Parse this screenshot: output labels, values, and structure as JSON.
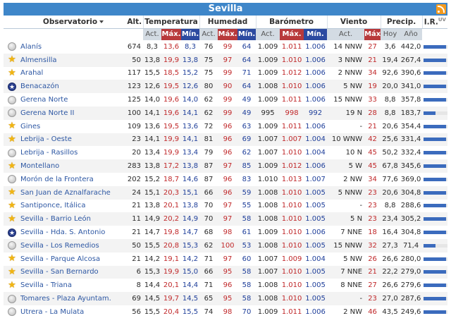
{
  "title": "Sevilla",
  "headers": {
    "observatorio": "Observatorio",
    "alt": "Alt.",
    "temperatura": "Temperatura",
    "humedad": "Humedad",
    "barometro": "Barómetro",
    "viento": "Viento",
    "precip": "Precip.",
    "ir": "I.R.",
    "ir_sup": "UV",
    "act": "Act.",
    "max": "Máx.",
    "min": "Mín.",
    "hoy": "Hoy",
    "ano": "Año"
  },
  "colors": {
    "title_bg": "#3e86c9",
    "max": "#c0282a",
    "min": "#1f3f9a",
    "link": "#2d57a3",
    "bar": "#3b6bbd"
  },
  "rows": [
    {
      "icon": "gray",
      "name": "Alanís",
      "alt": "674",
      "t_act": "8,3",
      "t_max": "13,6",
      "t_min": "8,3",
      "h_act": "76",
      "h_max": "99",
      "h_min": "64",
      "b_act": "1.009",
      "b_max": "1.011",
      "b_min": "1.006",
      "w_act": "14 NNW",
      "w_max": "27",
      "p_hoy": "3,6",
      "p_ano": "442,0",
      "ir": 0.95
    },
    {
      "icon": "star",
      "name": "Almensilla",
      "alt": "50",
      "t_act": "13,8",
      "t_max": "19,9",
      "t_min": "13,8",
      "h_act": "75",
      "h_max": "97",
      "h_min": "64",
      "b_act": "1.009",
      "b_max": "1.010",
      "b_min": "1.006",
      "w_act": "3 NNW",
      "w_max": "21",
      "p_hoy": "19,4",
      "p_ano": "267,4",
      "ir": 0.95
    },
    {
      "icon": "star",
      "name": "Arahal",
      "alt": "117",
      "t_act": "15,5",
      "t_max": "18,5",
      "t_min": "15,2",
      "h_act": "75",
      "h_max": "99",
      "h_min": "71",
      "b_act": "1.009",
      "b_max": "1.012",
      "b_min": "1.006",
      "w_act": "2 NNW",
      "w_max": "34",
      "p_hoy": "92,6",
      "p_ano": "390,6",
      "ir": 0.95
    },
    {
      "icon": "bluestar",
      "name": "Benacazón",
      "alt": "123",
      "t_act": "12,6",
      "t_max": "19,5",
      "t_min": "12,6",
      "h_act": "80",
      "h_max": "90",
      "h_min": "64",
      "b_act": "1.008",
      "b_max": "1.010",
      "b_min": "1.006",
      "w_act": "5 NW",
      "w_max": "19",
      "p_hoy": "20,0",
      "p_ano": "341,0",
      "ir": 0.95
    },
    {
      "icon": "gray",
      "name": "Gerena Norte",
      "alt": "125",
      "t_act": "14,0",
      "t_max": "19,6",
      "t_min": "14,0",
      "h_act": "62",
      "h_max": "99",
      "h_min": "49",
      "b_act": "1.009",
      "b_max": "1.011",
      "b_min": "1.006",
      "w_act": "15 NNW",
      "w_max": "33",
      "p_hoy": "8,8",
      "p_ano": "357,8",
      "ir": 0.95
    },
    {
      "icon": "gray",
      "name": "Gerena Norte II",
      "alt": "100",
      "t_act": "14,1",
      "t_max": "19,6",
      "t_min": "14,1",
      "h_act": "62",
      "h_max": "99",
      "h_min": "49",
      "b_act": "995",
      "b_max": "998",
      "b_min": "992",
      "w_act": "19 N",
      "w_max": "28",
      "p_hoy": "8,8",
      "p_ano": "183,7",
      "ir": 0.5
    },
    {
      "icon": "star",
      "name": "Gines",
      "alt": "109",
      "t_act": "13,6",
      "t_max": "19,5",
      "t_min": "13,6",
      "h_act": "72",
      "h_max": "96",
      "h_min": "63",
      "b_act": "1.009",
      "b_max": "1.011",
      "b_min": "1.006",
      "w_act": "-",
      "w_max": "21",
      "p_hoy": "20,6",
      "p_ano": "354,4",
      "ir": 0.95
    },
    {
      "icon": "star",
      "name": "Lebrija - Oeste",
      "alt": "23",
      "t_act": "14,1",
      "t_max": "19,9",
      "t_min": "14,1",
      "h_act": "81",
      "h_max": "96",
      "h_min": "69",
      "b_act": "1.007",
      "b_max": "1.007",
      "b_min": "1.004",
      "w_act": "10 WNW",
      "w_max": "42",
      "p_hoy": "25,6",
      "p_ano": "331,4",
      "ir": 0.95
    },
    {
      "icon": "gray",
      "name": "Lebrija - Rasillos",
      "alt": "20",
      "t_act": "13,4",
      "t_max": "19,9",
      "t_min": "13,4",
      "h_act": "79",
      "h_max": "96",
      "h_min": "62",
      "b_act": "1.007",
      "b_max": "1.010",
      "b_min": "1.004",
      "w_act": "10 N",
      "w_max": "45",
      "p_hoy": "50,2",
      "p_ano": "332,4",
      "ir": 0.95
    },
    {
      "icon": "star",
      "name": "Montellano",
      "alt": "283",
      "t_act": "13,8",
      "t_max": "17,2",
      "t_min": "13,8",
      "h_act": "87",
      "h_max": "97",
      "h_min": "85",
      "b_act": "1.009",
      "b_max": "1.012",
      "b_min": "1.006",
      "w_act": "5 W",
      "w_max": "45",
      "p_hoy": "67,8",
      "p_ano": "345,6",
      "ir": 0.95
    },
    {
      "icon": "gray",
      "name": "Morón de la Frontera",
      "alt": "202",
      "t_act": "15,2",
      "t_max": "18,7",
      "t_min": "14,6",
      "h_act": "87",
      "h_max": "96",
      "h_min": "83",
      "b_act": "1.010",
      "b_max": "1.013",
      "b_min": "1.007",
      "w_act": "2 NW",
      "w_max": "34",
      "p_hoy": "77,6",
      "p_ano": "369,0",
      "ir": 0.95
    },
    {
      "icon": "star",
      "name": "San Juan de Aznalfarache",
      "alt": "24",
      "t_act": "15,1",
      "t_max": "20,3",
      "t_min": "15,1",
      "h_act": "66",
      "h_max": "96",
      "h_min": "59",
      "b_act": "1.008",
      "b_max": "1.010",
      "b_min": "1.005",
      "w_act": "5 NNW",
      "w_max": "23",
      "p_hoy": "20,6",
      "p_ano": "304,8",
      "ir": 0.95
    },
    {
      "icon": "star",
      "name": "Santiponce, Itálica",
      "alt": "21",
      "t_act": "13,8",
      "t_max": "20,1",
      "t_min": "13,8",
      "h_act": "70",
      "h_max": "97",
      "h_min": "55",
      "b_act": "1.008",
      "b_max": "1.010",
      "b_min": "1.005",
      "w_act": "-",
      "w_max": "23",
      "p_hoy": "8,8",
      "p_ano": "288,6",
      "ir": 0.95
    },
    {
      "icon": "star",
      "name": "Sevilla - Barrio León",
      "alt": "11",
      "t_act": "14,9",
      "t_max": "20,2",
      "t_min": "14,9",
      "h_act": "70",
      "h_max": "97",
      "h_min": "58",
      "b_act": "1.008",
      "b_max": "1.010",
      "b_min": "1.005",
      "w_act": "5 N",
      "w_max": "23",
      "p_hoy": "23,4",
      "p_ano": "305,2",
      "ir": 0.95
    },
    {
      "icon": "bluestar",
      "name": "Sevilla - Hda. S. Antonio",
      "alt": "21",
      "t_act": "14,7",
      "t_max": "19,8",
      "t_min": "14,7",
      "h_act": "68",
      "h_max": "98",
      "h_min": "61",
      "b_act": "1.009",
      "b_max": "1.010",
      "b_min": "1.006",
      "w_act": "7 NNE",
      "w_max": "18",
      "p_hoy": "16,4",
      "p_ano": "304,8",
      "ir": 0.95
    },
    {
      "icon": "gray",
      "name": "Sevilla - Los Remedios",
      "alt": "50",
      "t_act": "15,5",
      "t_max": "20,8",
      "t_min": "15,3",
      "h_act": "62",
      "h_max": "100",
      "h_min": "53",
      "b_act": "1.008",
      "b_max": "1.010",
      "b_min": "1.005",
      "w_act": "15 NNW",
      "w_max": "32",
      "p_hoy": "27,3",
      "p_ano": "71,4",
      "ir": 0.5
    },
    {
      "icon": "star",
      "name": "Sevilla - Parque Alcosa",
      "alt": "21",
      "t_act": "14,2",
      "t_max": "19,1",
      "t_min": "14,2",
      "h_act": "71",
      "h_max": "97",
      "h_min": "60",
      "b_act": "1.007",
      "b_max": "1.009",
      "b_min": "1.004",
      "w_act": "5 NW",
      "w_max": "26",
      "p_hoy": "26,6",
      "p_ano": "280,0",
      "ir": 0.95
    },
    {
      "icon": "star",
      "name": "Sevilla - San Bernardo",
      "alt": "6",
      "t_act": "15,3",
      "t_max": "19,9",
      "t_min": "15,0",
      "h_act": "66",
      "h_max": "95",
      "h_min": "58",
      "b_act": "1.007",
      "b_max": "1.010",
      "b_min": "1.005",
      "w_act": "7 NNE",
      "w_max": "21",
      "p_hoy": "22,2",
      "p_ano": "279,0",
      "ir": 0.95
    },
    {
      "icon": "star",
      "name": "Sevilla - Triana",
      "alt": "8",
      "t_act": "14,4",
      "t_max": "20,1",
      "t_min": "14,4",
      "h_act": "71",
      "h_max": "96",
      "h_min": "58",
      "b_act": "1.008",
      "b_max": "1.010",
      "b_min": "1.005",
      "w_act": "8 NNE",
      "w_max": "27",
      "p_hoy": "26,6",
      "p_ano": "279,6",
      "ir": 0.95
    },
    {
      "icon": "gray",
      "name": "Tomares - Plaza Ayuntam.",
      "alt": "69",
      "t_act": "14,5",
      "t_max": "19,7",
      "t_min": "14,5",
      "h_act": "65",
      "h_max": "95",
      "h_min": "58",
      "b_act": "1.008",
      "b_max": "1.010",
      "b_min": "1.005",
      "w_act": "-",
      "w_max": "23",
      "p_hoy": "27,0",
      "p_ano": "287,6",
      "ir": 0.95
    },
    {
      "icon": "gray",
      "name": "Utrera - La Mulata",
      "alt": "56",
      "t_act": "15,5",
      "t_max": "20,4",
      "t_min": "15,5",
      "h_act": "74",
      "h_max": "98",
      "h_min": "70",
      "b_act": "1.009",
      "b_max": "1.011",
      "b_min": "1.006",
      "w_act": "2 NW",
      "w_max": "46",
      "p_hoy": "43,5",
      "p_ano": "249,6",
      "ir": 0.95
    }
  ]
}
